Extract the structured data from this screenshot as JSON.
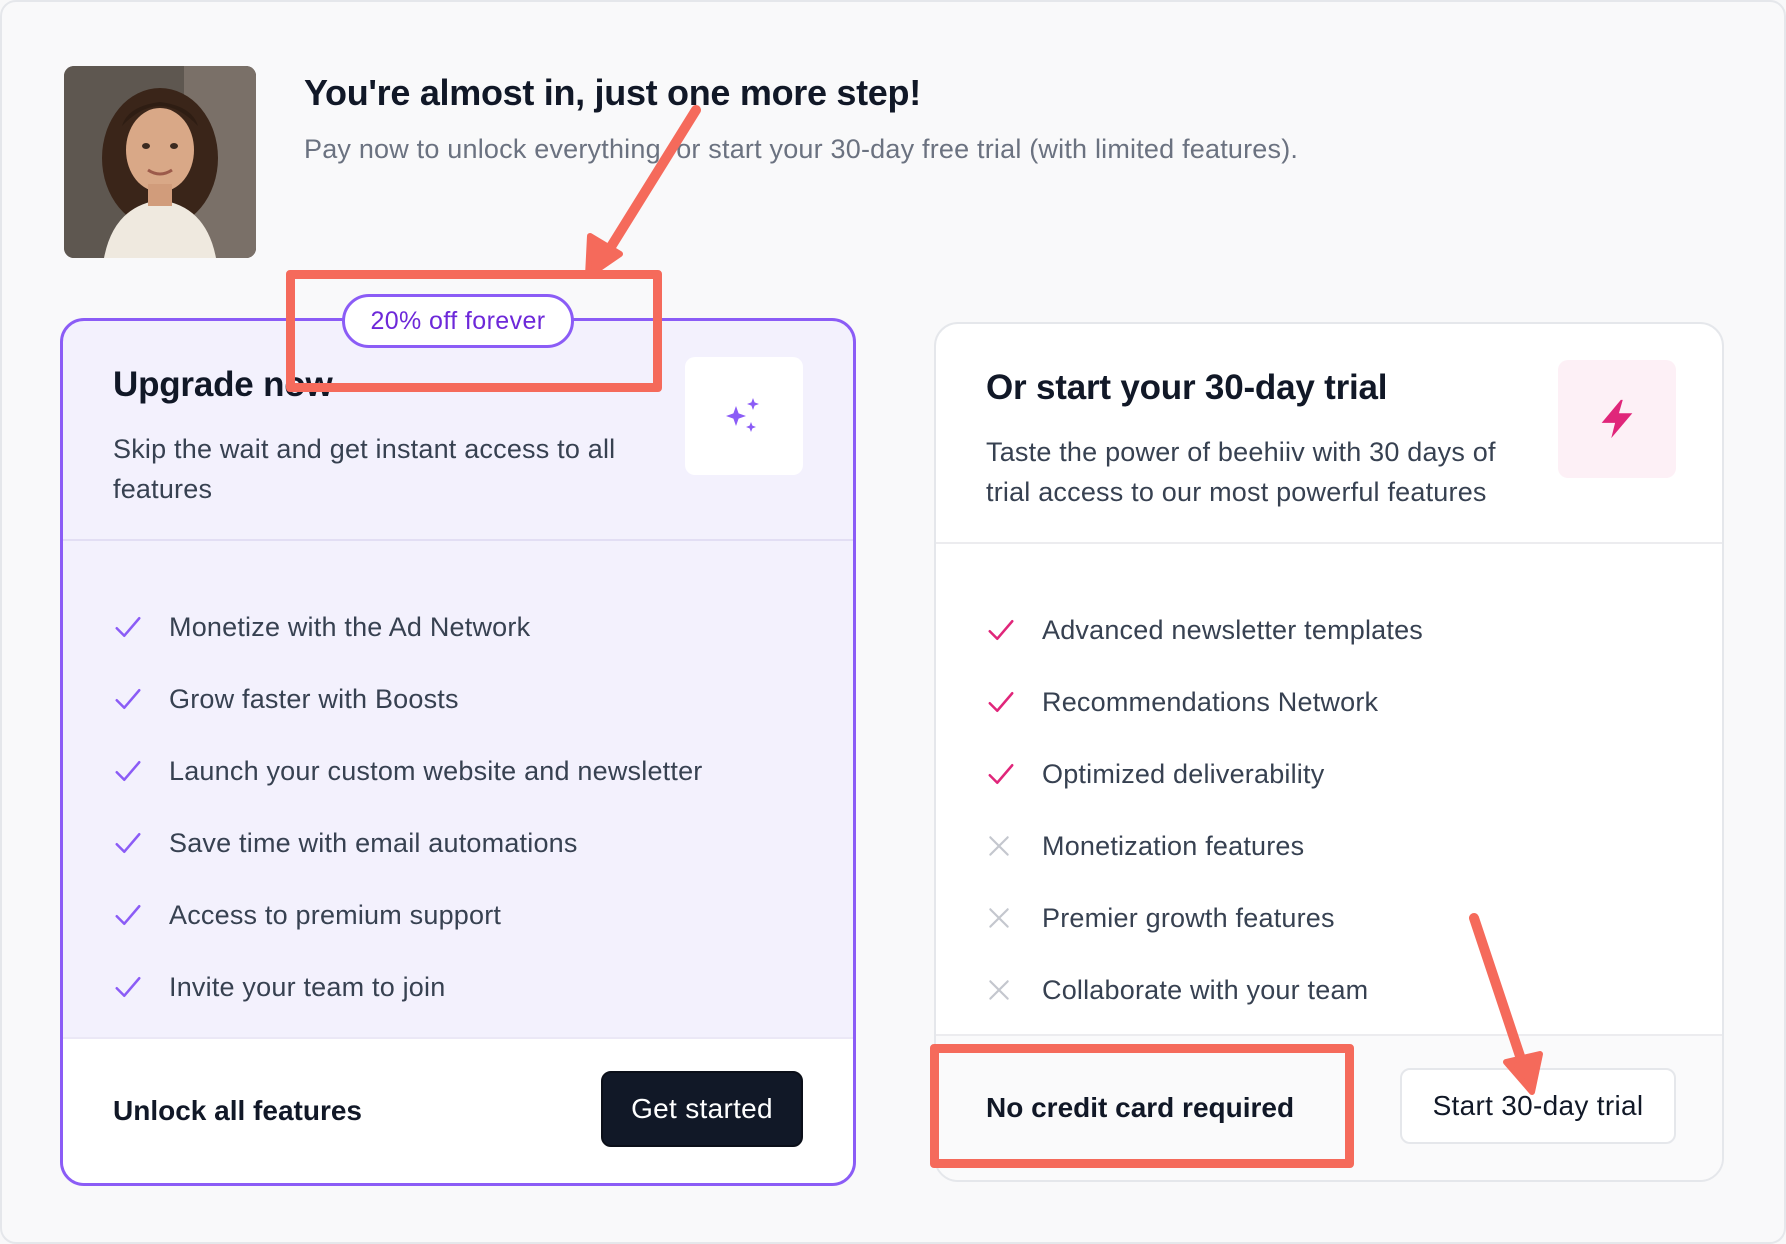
{
  "header": {
    "title": "You're almost in, just one more step!",
    "subtitle": "Pay now to unlock everything, or start your 30-day free trial (with limited features)."
  },
  "upgrade_card": {
    "badge": "20% off forever",
    "title": "Upgrade now",
    "description": "Skip the wait and get instant access to all features",
    "icon": "sparkles-icon",
    "features": [
      {
        "label": "Monetize with the Ad Network",
        "included": true
      },
      {
        "label": "Grow faster with Boosts",
        "included": true
      },
      {
        "label": "Launch your custom website and newsletter",
        "included": true
      },
      {
        "label": "Save time with email automations",
        "included": true
      },
      {
        "label": "Access to premium support",
        "included": true
      },
      {
        "label": "Invite your team to join",
        "included": true
      }
    ],
    "footer_label": "Unlock all features",
    "button_label": "Get started"
  },
  "trial_card": {
    "title": "Or start your 30-day trial",
    "description": "Taste the power of beehiiv with 30 days of trial access to our most powerful features",
    "icon": "lightning-bolt-icon",
    "features": [
      {
        "label": "Advanced newsletter templates",
        "included": true
      },
      {
        "label": "Recommendations Network",
        "included": true
      },
      {
        "label": "Optimized deliverability",
        "included": true
      },
      {
        "label": "Monetization features",
        "included": false
      },
      {
        "label": "Premier growth features",
        "included": false
      },
      {
        "label": "Collaborate with your team",
        "included": false
      }
    ],
    "footer_label": "No credit card required",
    "button_label": "Start 30-day trial"
  },
  "colors": {
    "upgrade_accent": "#8b5cf6",
    "trial_accent": "#e0267a",
    "excluded_mark": "#c4c7ce",
    "annotation": "#f56a5b"
  }
}
